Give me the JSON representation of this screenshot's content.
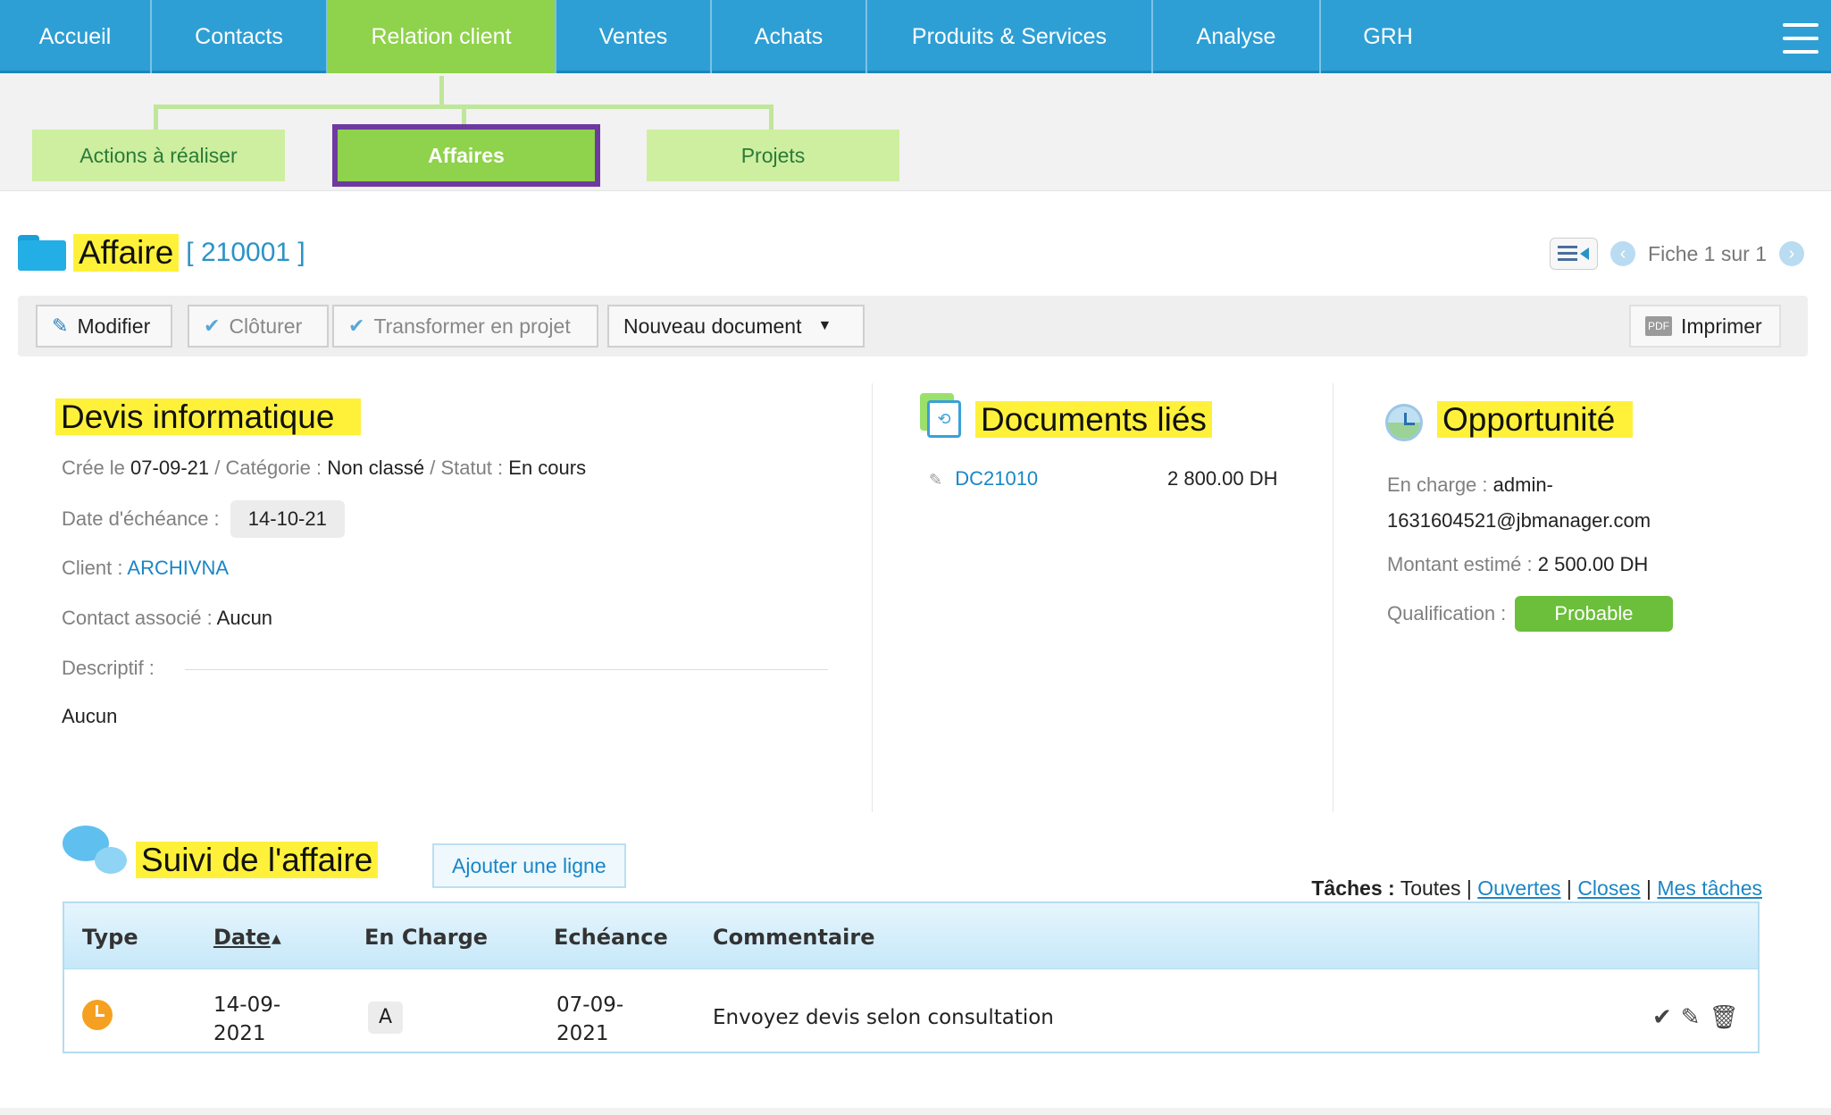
{
  "nav": {
    "items": [
      {
        "label": "Accueil"
      },
      {
        "label": "Contacts"
      },
      {
        "label": "Relation client"
      },
      {
        "label": "Ventes"
      },
      {
        "label": "Achats"
      },
      {
        "label": "Produits & Services"
      },
      {
        "label": "Analyse"
      },
      {
        "label": "GRH"
      }
    ],
    "active": "Relation client",
    "menu_icon": "hamburger-icon"
  },
  "subtabs": [
    {
      "label": "Actions à réaliser"
    },
    {
      "label": "Affaires"
    },
    {
      "label": "Projets"
    }
  ],
  "header": {
    "title": "Affaire",
    "ref": "[ 210001 ]",
    "pager_text": "Fiche 1 sur 1"
  },
  "toolbar": {
    "modify": "Modifier",
    "close": "Clôturer",
    "transform": "Transformer en projet",
    "new_doc": "Nouveau document",
    "print": "Imprimer",
    "print_icon_text": "PDF"
  },
  "deal": {
    "name": "Devis informatique",
    "created_label": "Crée le",
    "created": "07-09-21",
    "category_label": "Catégorie :",
    "category": "Non classé",
    "status_label": "Statut :",
    "status": "En cours",
    "due_label": "Date d'échéance :",
    "due": "14-10-21",
    "client_label": "Client :",
    "client": "ARCHIVNA",
    "contact_label": "Contact associé :",
    "contact": "Aucun",
    "desc_label": "Descriptif :",
    "desc": "Aucun"
  },
  "documents": {
    "title": "Documents liés",
    "items": [
      {
        "ref": "DC21010",
        "amount": "2 800.00 DH"
      }
    ]
  },
  "opportunity": {
    "title": "Opportunité",
    "owner_label": "En charge :",
    "owner_line1": "admin-",
    "owner_line2": "1631604521@jbmanager.com",
    "amount_label": "Montant estimé :",
    "amount": "2 500.00 DH",
    "qual_label": "Qualification :",
    "qual": "Probable"
  },
  "followup": {
    "title": "Suivi de l'affaire",
    "add_button": "Ajouter une ligne",
    "filters_label": "Tâches :",
    "filter_all": "Toutes",
    "filter_open": "Ouvertes",
    "filter_closed": "Closes",
    "filter_mine": "Mes tâches",
    "columns": [
      "Type",
      "Date",
      "En Charge",
      "Echéance",
      "Commentaire"
    ],
    "rows": [
      {
        "date_line1": "14-09-",
        "date_line2": "2021",
        "owner": "A",
        "due_line1": "07-09-",
        "due_line2": "2021",
        "comment": "Envoyez devis selon consultation"
      }
    ]
  },
  "colors": {
    "nav_bg": "#2e9fd4",
    "active_green": "#8fd24b",
    "highlight": "#fff13a",
    "link": "#1a86c6",
    "badge_green": "#6bbf3a"
  }
}
